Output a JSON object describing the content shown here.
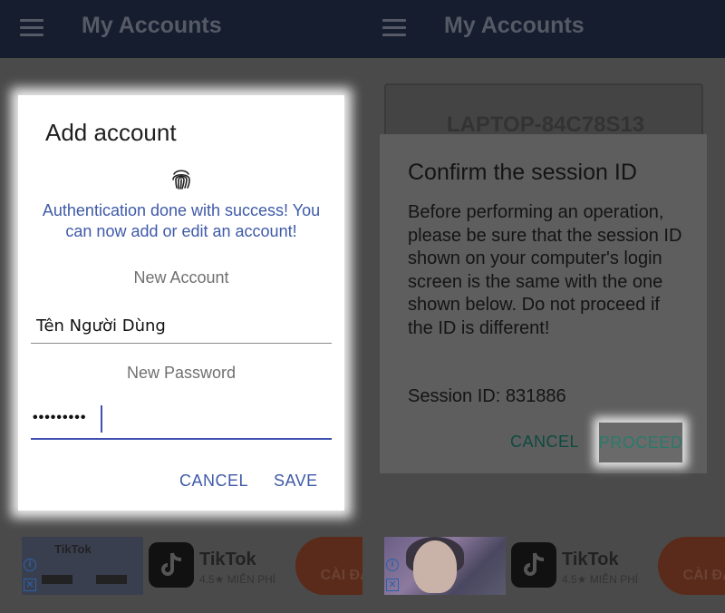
{
  "left": {
    "appbar": {
      "title": "My Accounts"
    },
    "dialog": {
      "title": "Add account",
      "auth_message": "Authentication done with success! You can now add or edit an account!",
      "new_account_label": "New Account",
      "account_value": "Tên Người Dùng",
      "new_password_label": "New Password",
      "password_value": "•••••••••",
      "cancel_label": "CANCEL",
      "save_label": "SAVE"
    },
    "ad": {
      "thumb_text": "TikTok",
      "app_name": "TikTok",
      "rating": "4.5★ MIỄN PHÍ",
      "install_label": "CÀI ĐẶT"
    }
  },
  "right": {
    "appbar": {
      "title": "My Accounts"
    },
    "computer_name": "LAPTOP-84C78S13",
    "dialog": {
      "title": "Confirm the session ID",
      "body": "Before performing an operation, please be sure that the session ID shown on your computer's login screen is the same with the one shown below. Do not proceed if the ID is different!",
      "session_label": "Session ID: 831886",
      "cancel_label": "CANCEL",
      "proceed_label": "PROCEED"
    },
    "ad": {
      "app_name": "TikTok",
      "rating": "4.5★ MIỄN PHÍ",
      "install_label": "CÀI ĐẶT"
    }
  },
  "colors": {
    "appbar": "#161d2e",
    "accent_blue": "#3f5aa8",
    "accent_teal": "#2a7a6a"
  },
  "icons": [
    "menu-icon",
    "fingerprint-icon",
    "info-icon",
    "close-icon",
    "tiktok-icon"
  ]
}
